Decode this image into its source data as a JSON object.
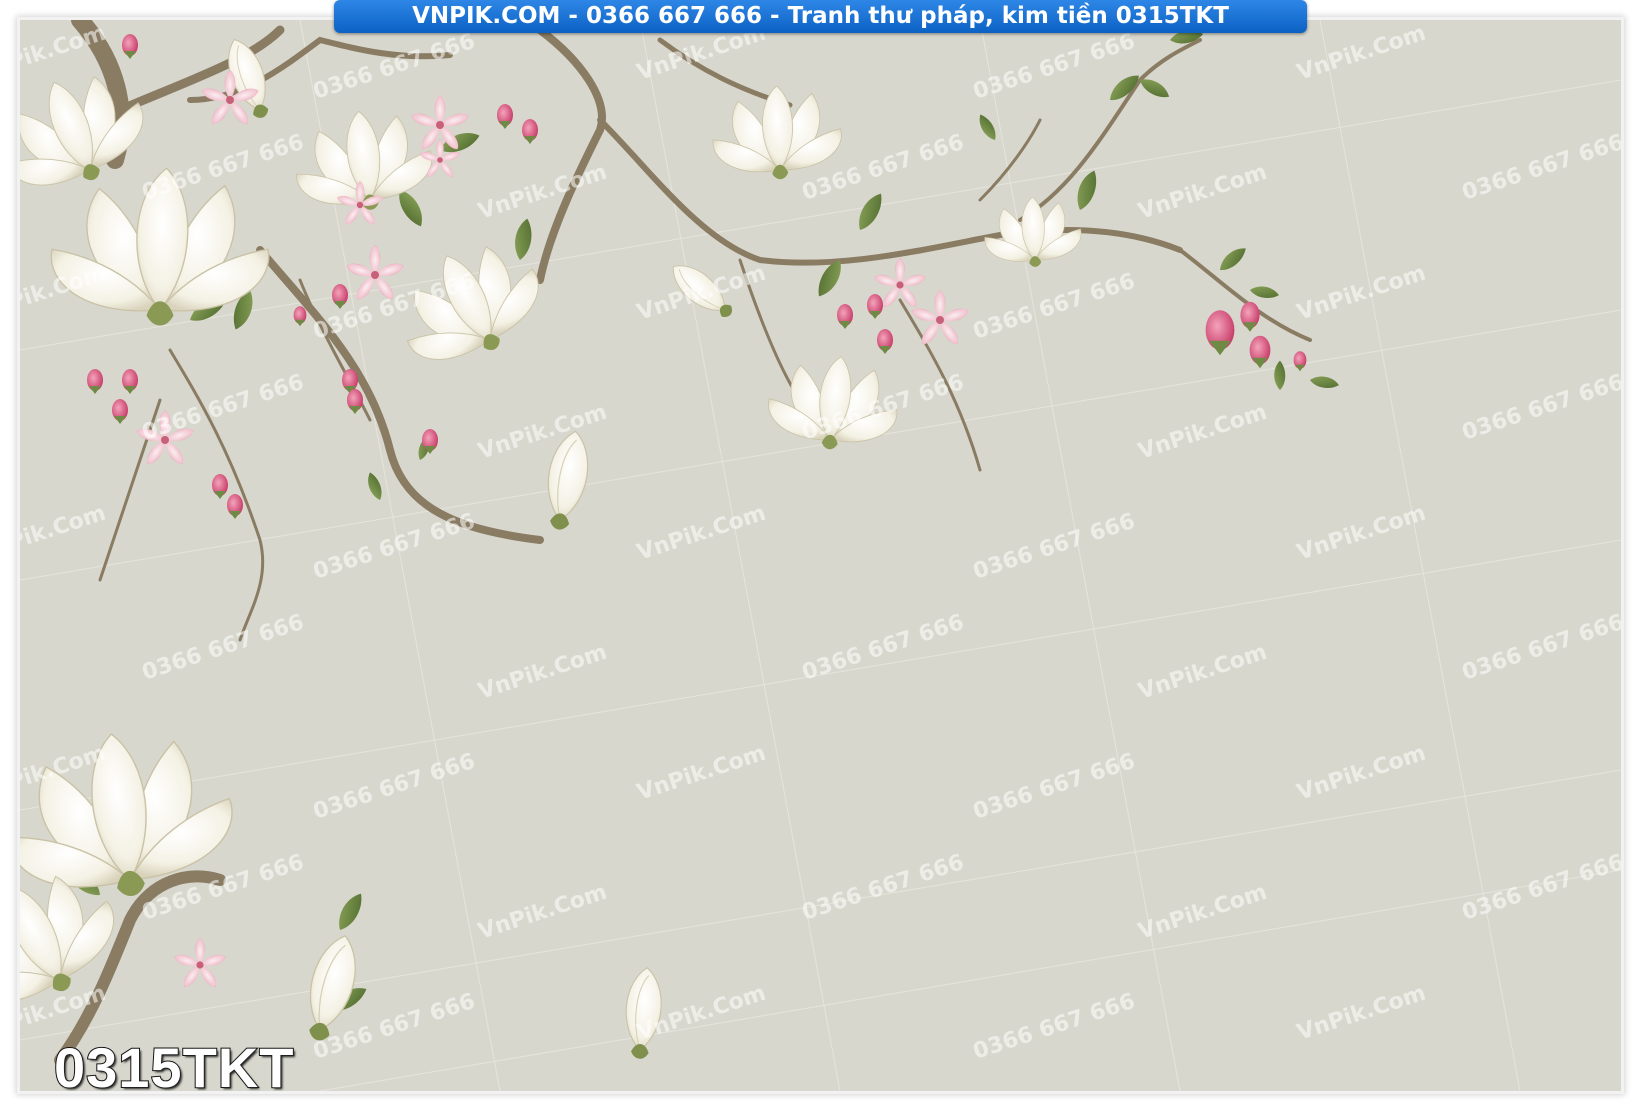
{
  "banner": {
    "text": "VNPIK.COM - 0366 667 666 - Tranh thư pháp, kim tiền 0315TKT"
  },
  "product": {
    "code": "0315TKT"
  },
  "watermarks": {
    "brand": "VnPik.Com",
    "phone": "0366 667 666"
  },
  "colors": {
    "background": "#d8d7cd",
    "banner": "#1673d8",
    "branch": "#8a7b63",
    "petal_white": "#f6f3e8",
    "petal_pink": "#e8a7b7",
    "bud_pink": "#d95c86",
    "leaf": "#6f8a45"
  },
  "image": {
    "subject": "magnolia and cherry blossom branches on a pale grey-green background",
    "style": "traditional painted wallpaper"
  }
}
